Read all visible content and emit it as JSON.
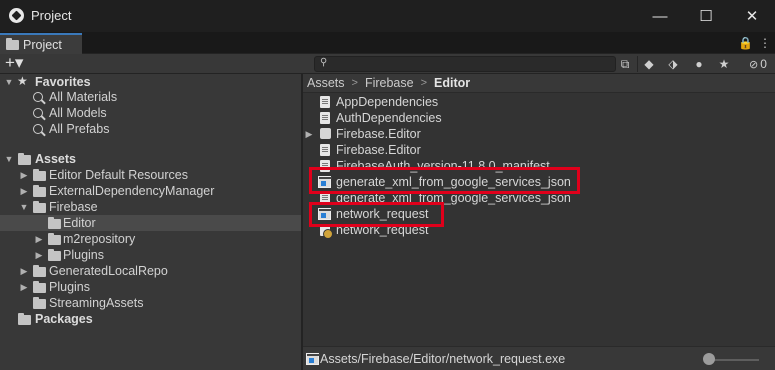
{
  "window": {
    "title": "Project",
    "minimize_glyph": "—",
    "maximize_glyph": "☐",
    "close_glyph": "✕"
  },
  "tab": {
    "label": "Project",
    "lock_glyph": "🔒",
    "menu_glyph": "⋮"
  },
  "toolbar": {
    "add_glyph": "+▾",
    "search_placeholder": "",
    "search_value": "",
    "icons": [
      "search-in-scene-icon",
      "filter-by-type-icon",
      "filter-by-label-icon",
      "important-icon",
      "favorite-star-icon",
      "hidden-packages-icon"
    ],
    "hidden_packages_count": "0"
  },
  "tree": {
    "favorites": {
      "label": "Favorites",
      "items": [
        "All Materials",
        "All Models",
        "All Prefabs"
      ]
    },
    "assets": {
      "label": "Assets",
      "children": [
        {
          "label": "Editor Default Resources"
        },
        {
          "label": "ExternalDependencyManager"
        },
        {
          "label": "Firebase"
        },
        {
          "label": "Editor"
        },
        {
          "label": "m2repository"
        },
        {
          "label": "Plugins"
        },
        {
          "label": "GeneratedLocalRepo"
        },
        {
          "label": "Plugins"
        },
        {
          "label": "StreamingAssets"
        }
      ]
    },
    "packages": {
      "label": "Packages"
    }
  },
  "breadcrumb": [
    "Assets",
    "Firebase",
    "Editor"
  ],
  "files": [
    {
      "label": "AppDependencies",
      "icon": "text-document-icon"
    },
    {
      "label": "AuthDependencies",
      "icon": "text-document-icon"
    },
    {
      "label": "Firebase.Editor",
      "icon": "assembly-icon"
    },
    {
      "label": "Firebase.Editor",
      "icon": "text-document-icon"
    },
    {
      "label": "FirebaseAuth_version-11.8.0_manifest",
      "icon": "text-document-icon"
    },
    {
      "label": "generate_xml_from_google_services_json",
      "icon": "executable-icon"
    },
    {
      "label": "generate_xml_from_google_services_json",
      "icon": "python-script-icon"
    },
    {
      "label": "network_request",
      "icon": "executable-icon"
    },
    {
      "label": "network_request",
      "icon": "python-script-icon"
    }
  ],
  "status": {
    "path": "Assets/Firebase/Editor/network_request.exe"
  },
  "colors": {
    "highlight": "#e0001b",
    "tab_accent": "#3a79bb"
  }
}
